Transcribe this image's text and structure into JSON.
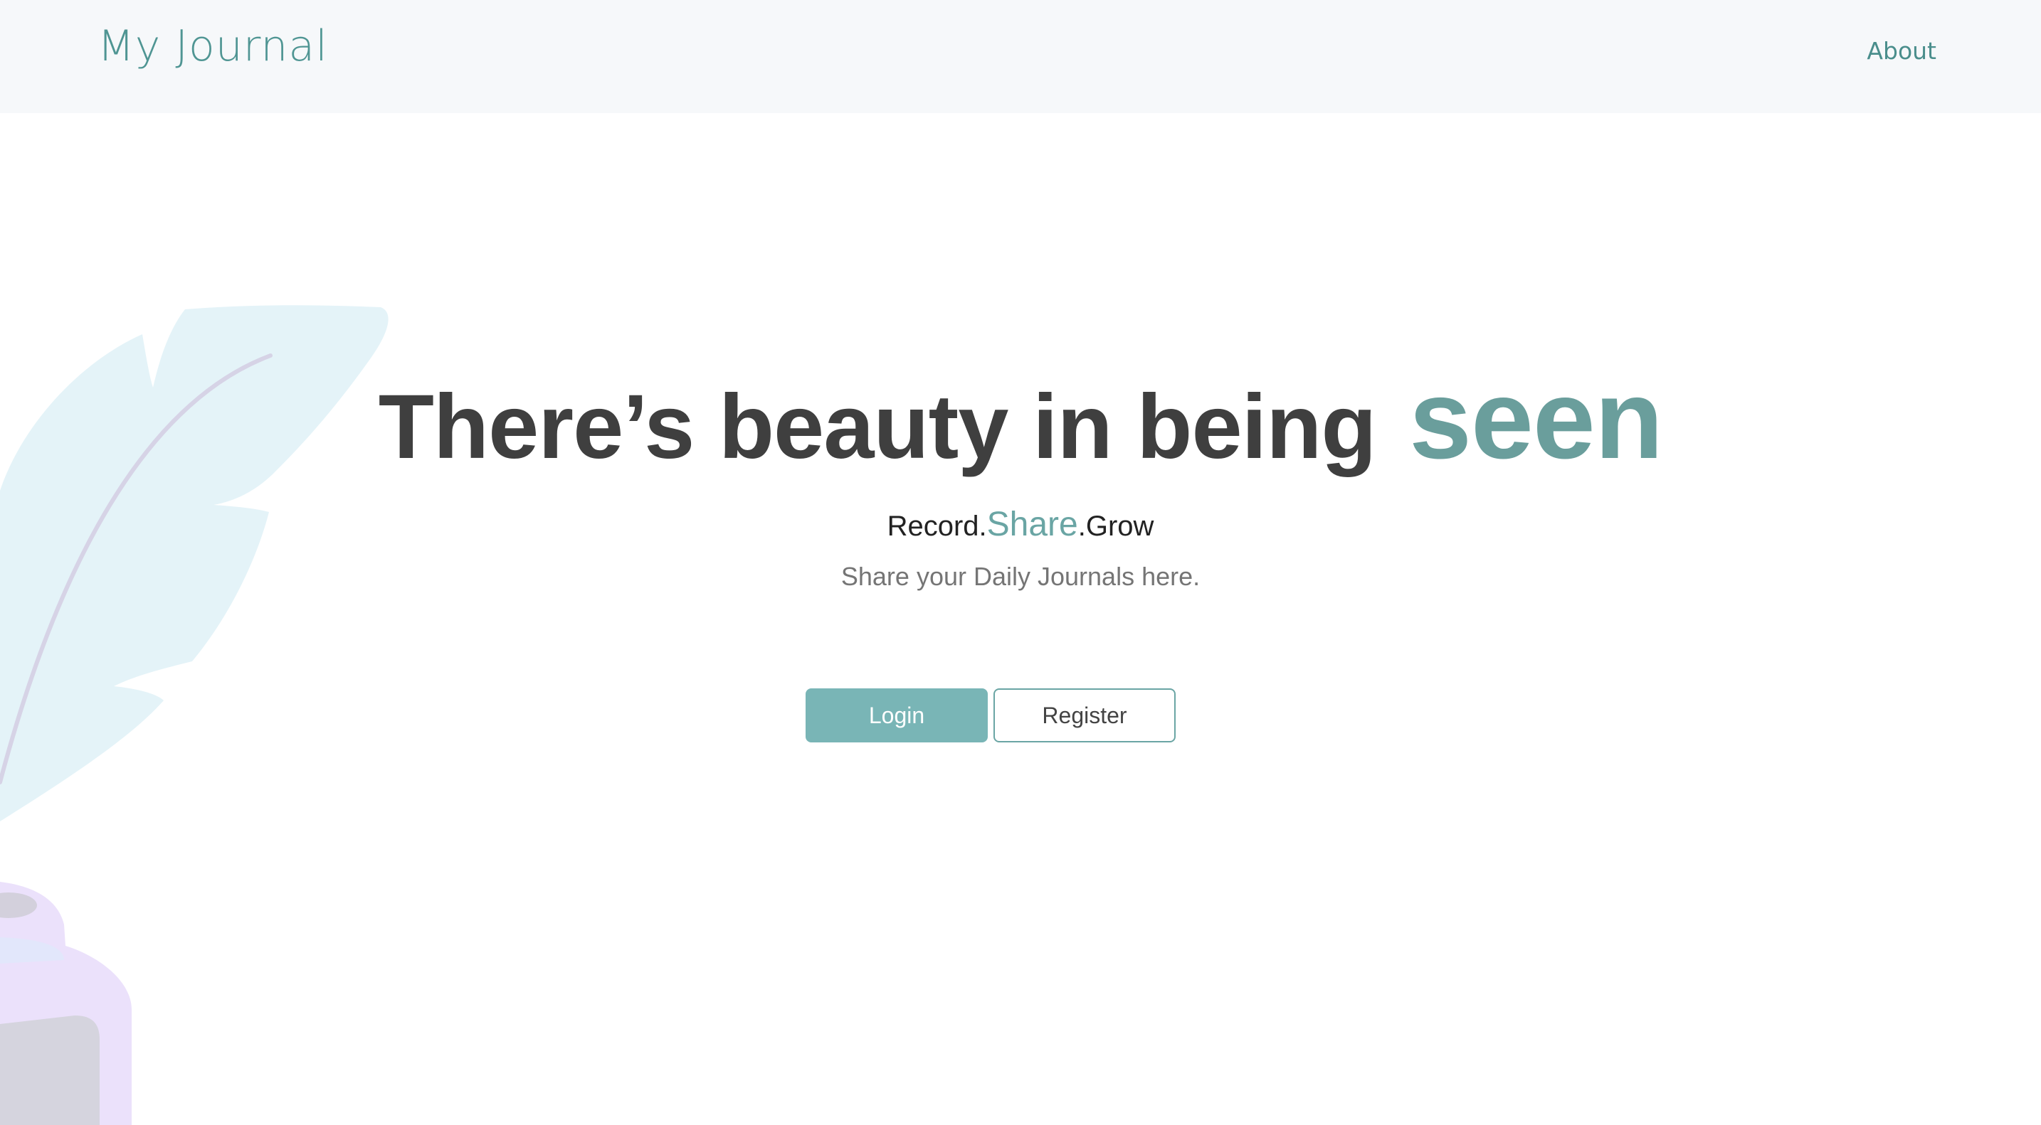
{
  "navbar": {
    "brand": "My Journal",
    "about_link": "About"
  },
  "hero": {
    "headline_main": "There’s beauty in being",
    "headline_accent": "seen",
    "tagline": {
      "part1": "Record.",
      "part2": "Share",
      "part3": ".Grow"
    },
    "subtext": "Share your Daily Journals here."
  },
  "actions": {
    "login_label": "Login",
    "register_label": "Register"
  },
  "colors": {
    "accent": "#6a9e9c",
    "login_button": "#79b5b6",
    "navbar_bg": "#f6f8fa",
    "headline": "#3f3f3f"
  },
  "icons": {
    "feather": "feather-illustration",
    "inkpot": "inkpot-illustration"
  }
}
